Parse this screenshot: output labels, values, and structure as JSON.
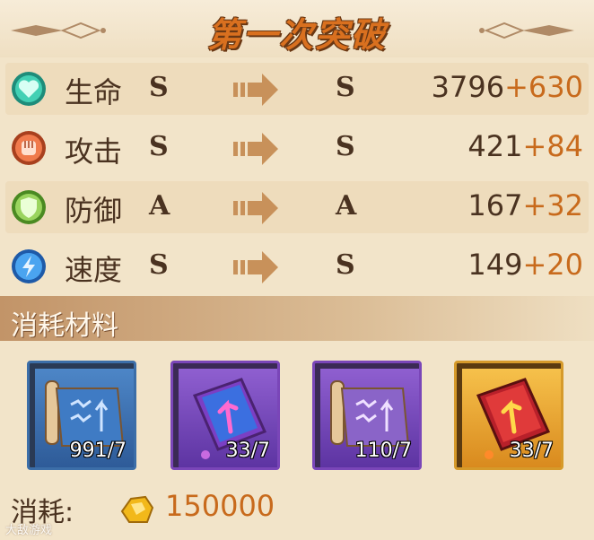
{
  "title": "第一次突破",
  "stats": [
    {
      "name": "生命",
      "icon": "heart-icon",
      "from": "S",
      "to": "S",
      "base": "3796",
      "bonus": "+630",
      "color": "#2fb8a0"
    },
    {
      "name": "攻击",
      "icon": "fist-icon",
      "from": "S",
      "to": "S",
      "base": "421",
      "bonus": "+84",
      "color": "#e0643c"
    },
    {
      "name": "防御",
      "icon": "shield-icon",
      "from": "A",
      "to": "A",
      "base": "167",
      "bonus": "+32",
      "color": "#7cc04a"
    },
    {
      "name": "速度",
      "icon": "lightning-icon",
      "from": "S",
      "to": "S",
      "base": "149",
      "bonus": "+20",
      "color": "#3c8ee0"
    }
  ],
  "materials_header": "消耗材料",
  "materials": [
    {
      "count": "991/7",
      "icon": "scroll-icon",
      "rarity": "blue"
    },
    {
      "count": "33/7",
      "icon": "book-icon",
      "rarity": "purple"
    },
    {
      "count": "110/7",
      "icon": "scroll-icon",
      "rarity": "purple"
    },
    {
      "count": "33/7",
      "icon": "book-icon",
      "rarity": "gold"
    }
  ],
  "cost": {
    "label": "消耗:",
    "value": "150000",
    "icon": "gold-coin-icon"
  },
  "watermark": "大敌游戏"
}
